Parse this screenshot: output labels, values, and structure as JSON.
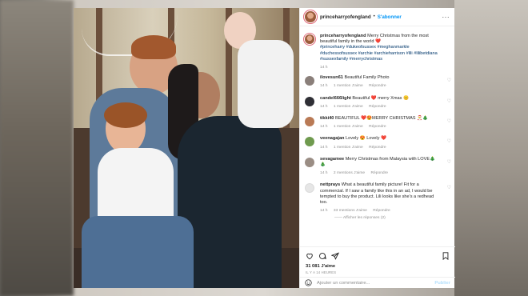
{
  "post": {
    "username": "princeharryofengland",
    "separator": "•",
    "follow_label": "S'abonner",
    "more_label": "···"
  },
  "caption": {
    "username": "princeharryofengland",
    "text": "Merry Christmas from the most beautiful family in the world ❤️",
    "hashtags": "#princeharry #dukeofsussex #meghanmarkle #duchessofsussex #archie #archieharrison #lili #lilibetdiana #sussexfamily #merrychristmas",
    "time": "14 h"
  },
  "comments": [
    {
      "username": "ilovesun61",
      "text": "Beautiful Family Photo",
      "time": "14 h",
      "likes": "1 mention J'aime",
      "reply": "Répondre",
      "avatar_color": "#8a7f7a"
    },
    {
      "username": "candel666light",
      "text": "Beautiful ❤️ merry Xmas 😊",
      "time": "14 h",
      "likes": "1 mention J'aime",
      "reply": "Répondre",
      "avatar_color": "#2f2f35"
    },
    {
      "username": "tikki40",
      "text": "BEAUTIFUL ❤️😍MERRY CHRISTMAS 🎅🎄",
      "time": "14 h",
      "likes": "1 mention J'aime",
      "reply": "Répondre",
      "avatar_color": "#b97a55"
    },
    {
      "username": "veenagajan",
      "text": "Lovely 😍 Lovely ❤️",
      "time": "14 h",
      "likes": "1 mention J'aime",
      "reply": "Répondre",
      "avatar_color": "#6f9a4e"
    },
    {
      "username": "sevagamee",
      "text": "Merry Christmas from Malaysia with LOVE🎄🎄",
      "time": "14 h",
      "likes": "2 mentions J'aime",
      "reply": "Répondre",
      "avatar_color": "#9a8d84"
    },
    {
      "username": "nettprays",
      "text": "What a beautiful family picture! Fit for a commercial. If I saw a family like this in an ad, I would be tempted to buy the product. Lili looks like she's a redhead too.",
      "time": "14 h",
      "likes": "33 mentions J'aime",
      "reply": "Répondre",
      "avatar_color": "#e6e6e6",
      "replies": "Afficher les réponses (2)"
    }
  ],
  "footer": {
    "likes": "31 081 J'aime",
    "date": "IL Y A 14 HEURES",
    "add_placeholder": "Ajouter un commentaire...",
    "publish_label": "Publier"
  },
  "icons": [
    "heart-icon",
    "comment-icon",
    "share-icon",
    "bookmark-icon",
    "emoji-icon",
    "more-icon"
  ]
}
